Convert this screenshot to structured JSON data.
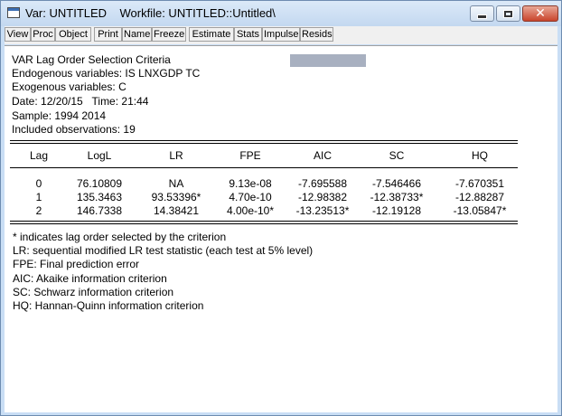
{
  "window": {
    "title": "Var: UNTITLED    Workfile: UNTITLED::Untitled\\",
    "close_symbol": "✕"
  },
  "toolbar": {
    "buttons": [
      "View",
      "Proc",
      "Object",
      "Print",
      "Name",
      "Freeze",
      "Estimate",
      "Stats",
      "Impulse",
      "Resids"
    ]
  },
  "report": {
    "title": "VAR Lag Order Selection Criteria",
    "endogenous": "Endogenous variables: IS LNXGDP TC",
    "exogenous": "Exogenous variables: C",
    "date": "Date: 12/20/15   Time: 21:44",
    "sample": "Sample: 1994 2014",
    "observations": "Included observations: 19",
    "table": {
      "headers": [
        "Lag",
        "LogL",
        "LR",
        "FPE",
        "AIC",
        "SC",
        "HQ"
      ],
      "rows": [
        [
          "0",
          "76.10809",
          "NA",
          "9.13e-08",
          "-7.695588",
          "-7.546466",
          "-7.670351"
        ],
        [
          "1",
          "135.3463",
          "93.53396*",
          "4.70e-10",
          "-12.98382",
          "-12.38733*",
          "-12.88287"
        ],
        [
          "2",
          "146.7338",
          "14.38421",
          "4.00e-10*",
          "-13.23513*",
          "-12.19128",
          "-13.05847*"
        ]
      ]
    },
    "notes": [
      "* indicates lag order selected by the criterion",
      "LR: sequential modified LR test statistic (each test at 5% level)",
      "FPE: Final prediction error",
      "AIC: Akaike information criterion",
      "SC: Schwarz information criterion",
      "HQ: Hannan-Quinn information criterion"
    ]
  }
}
